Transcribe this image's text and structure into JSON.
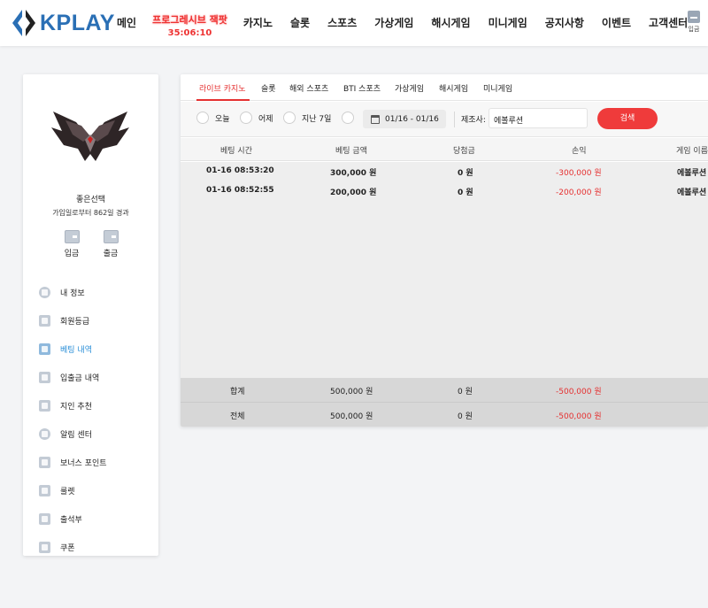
{
  "brand": {
    "name": "KPLAY",
    "color": "#2a6fb5"
  },
  "nav": {
    "items": [
      "메인",
      "카지노",
      "슬롯",
      "스포츠",
      "가상게임",
      "해시게임",
      "미니게임",
      "공지사항",
      "이벤트",
      "고객센터"
    ],
    "promo_label": "프로그레시브 잭팟",
    "promo_time": "35:06:10",
    "deposit_label": "입금"
  },
  "sidebar": {
    "user_name": "좋은선택",
    "user_days": "가입일로부터 862일 경과",
    "quick": {
      "deposit": "입금",
      "withdraw": "출금"
    },
    "menu": [
      {
        "label": "내 정보",
        "icon": "user-icon"
      },
      {
        "label": "회원등급",
        "icon": "grade-icon"
      },
      {
        "label": "베팅 내역",
        "icon": "betting-history-icon",
        "active": true
      },
      {
        "label": "입출금 내역",
        "icon": "transaction-icon"
      },
      {
        "label": "지인 추천",
        "icon": "referral-icon"
      },
      {
        "label": "알림 센터",
        "icon": "chat-icon"
      },
      {
        "label": "보너스 포인트",
        "icon": "bonus-icon"
      },
      {
        "label": "룰렛",
        "icon": "roulette-icon"
      },
      {
        "label": "출석부",
        "icon": "attendance-icon"
      },
      {
        "label": "쿠폰",
        "icon": "coupon-icon"
      }
    ]
  },
  "tabs": [
    "라이브 카지노",
    "슬롯",
    "해외 스포츠",
    "BTI 스포츠",
    "가상게임",
    "해시게임",
    "미니게임"
  ],
  "filter": {
    "options": [
      "오늘",
      "어제",
      "지난 7일",
      ""
    ],
    "date_range": "01/16 - 01/16",
    "provider_label": "제조사:",
    "provider_value": "에볼루션",
    "search_label": "검색"
  },
  "table": {
    "headers": [
      "베팅 시간",
      "베팅 금액",
      "당첨금",
      "손익",
      "게임 이름"
    ],
    "rows": [
      {
        "time": "01-16 08:53:20",
        "amount": "300,000 원",
        "win": "0 원",
        "profit": "-300,000 원",
        "game": "에볼루션"
      },
      {
        "time": "01-16 08:52:55",
        "amount": "200,000 원",
        "win": "0 원",
        "profit": "-200,000 원",
        "game": "에볼루션"
      }
    ],
    "totals": [
      {
        "label": "합계",
        "amount": "500,000 원",
        "win": "0 원",
        "profit": "-500,000 원"
      },
      {
        "label": "전체",
        "amount": "500,000 원",
        "win": "0 원",
        "profit": "-500,000 원"
      }
    ]
  },
  "colors": {
    "accent_red": "#e53030",
    "active_blue": "#2a8fd8"
  }
}
